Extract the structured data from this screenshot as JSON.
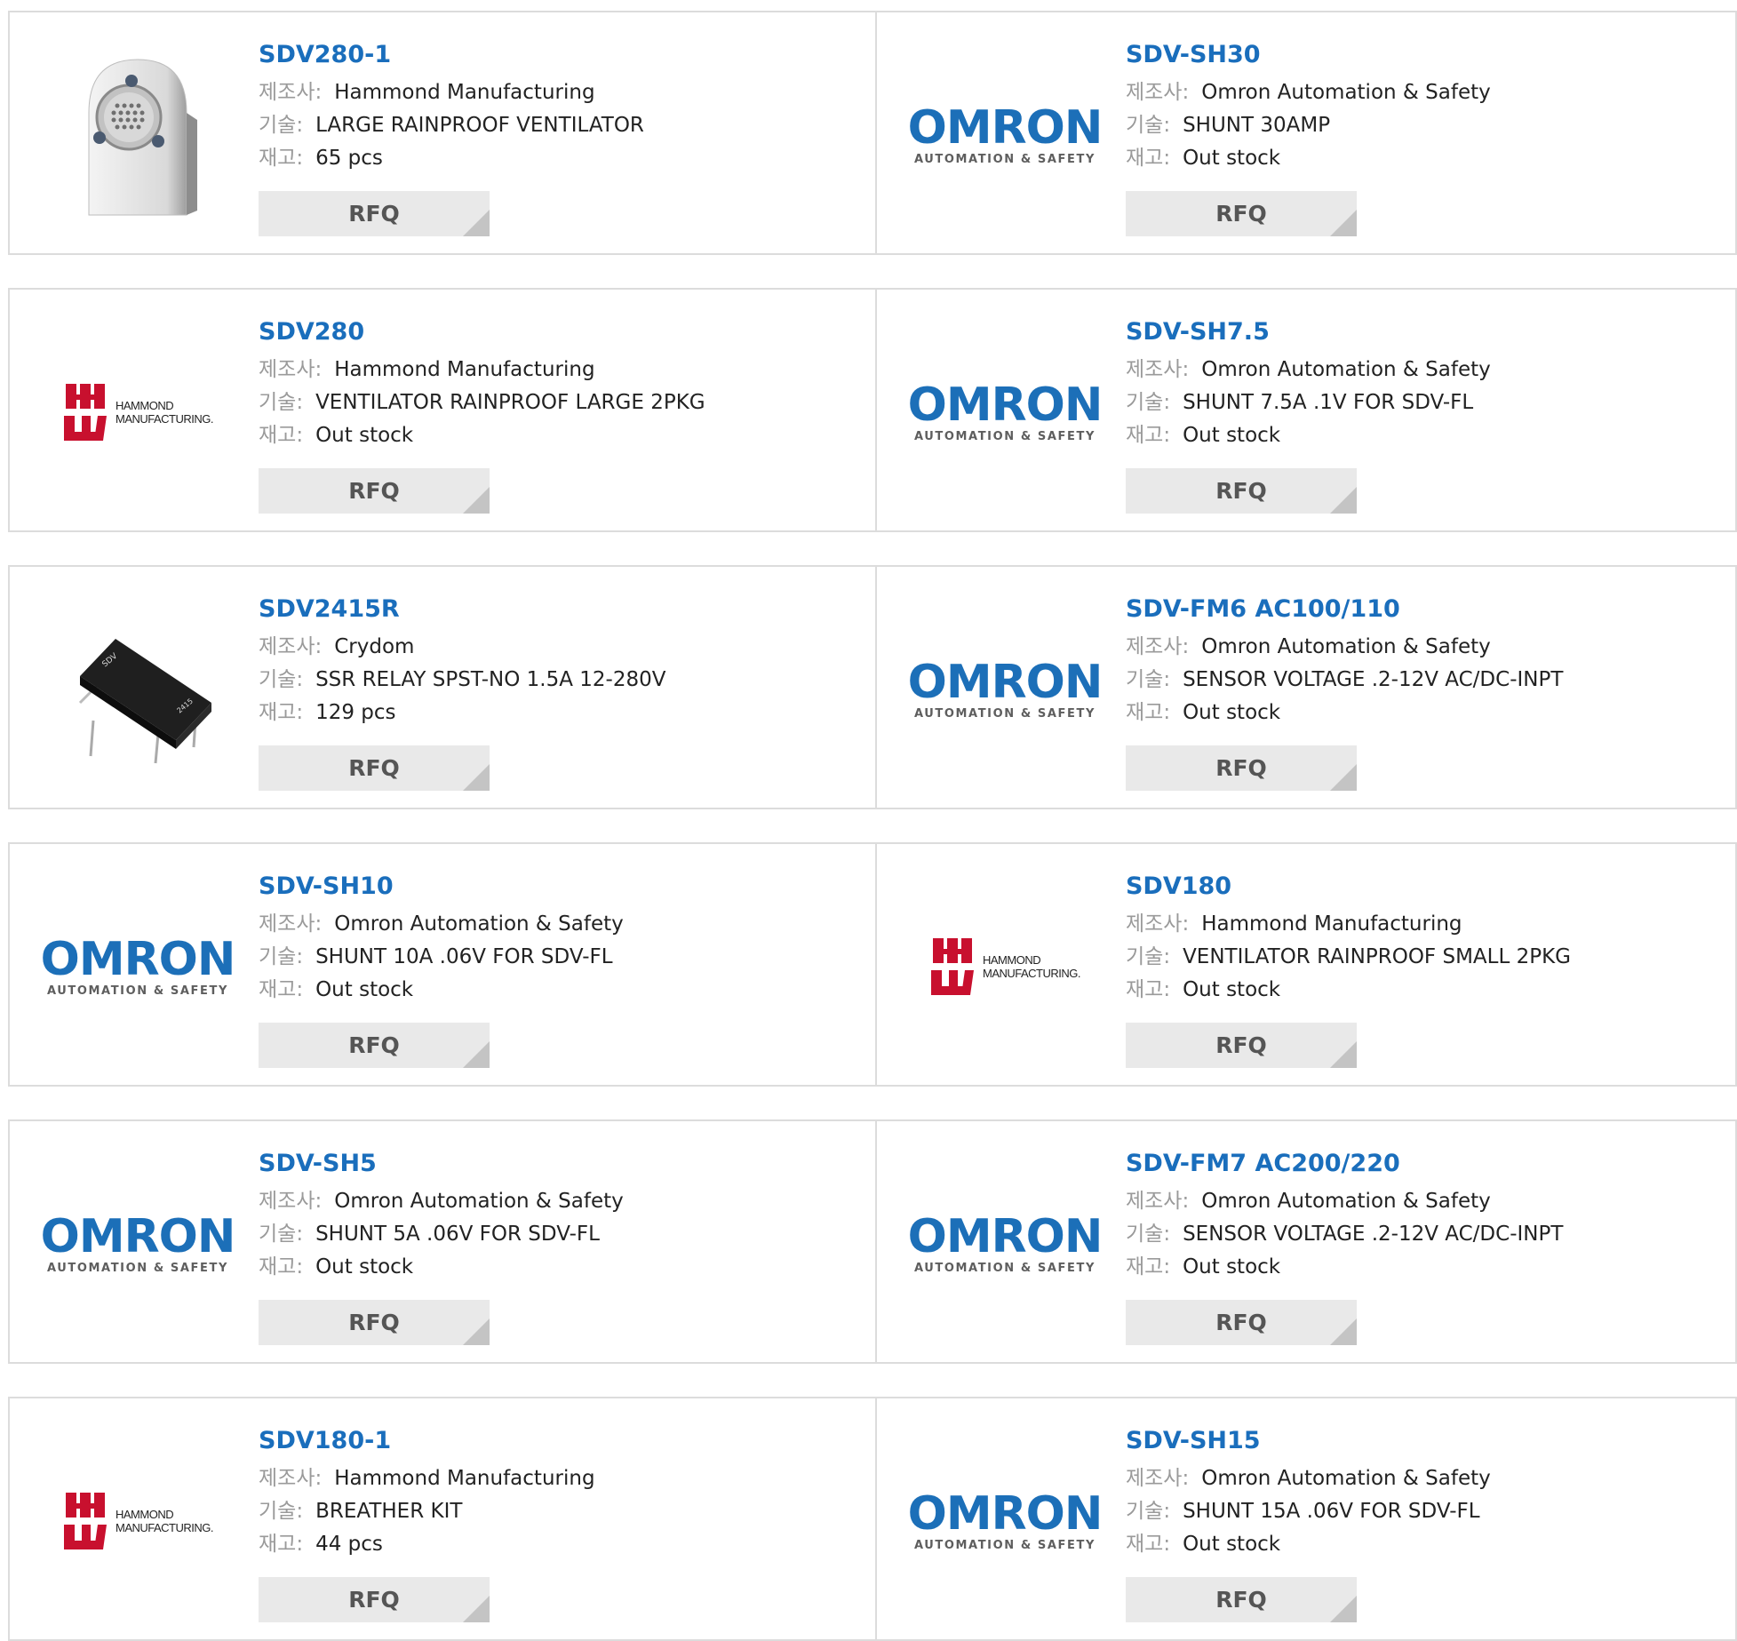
{
  "labels": {
    "manufacturer": "제조사",
    "description": "기술",
    "stock": "재고",
    "colon": ":"
  },
  "rfq_label": "RFQ",
  "logos": {
    "omron": {
      "name": "OMRON",
      "tagline": "AUTOMATION & SAFETY",
      "color": "#1c6fb8"
    },
    "hammond": {
      "line1": "HAMMOND",
      "line2": "MANUFACTURING.",
      "color": "#c8102e"
    }
  },
  "rows": [
    [
      {
        "part": "SDV280-1",
        "manufacturer": "Hammond Manufacturing",
        "description": "LARGE RAINPROOF VENTILATOR",
        "stock": "65 pcs",
        "image": "ventilator-photo"
      },
      {
        "part": "SDV-SH30",
        "manufacturer": "Omron Automation & Safety",
        "description": "SHUNT 30AMP",
        "stock": "Out stock",
        "image": "omron-logo"
      }
    ],
    [
      {
        "part": "SDV280",
        "manufacturer": "Hammond Manufacturing",
        "description": "VENTILATOR RAINPROOF LARGE 2PKG",
        "stock": "Out stock",
        "image": "hammond-logo"
      },
      {
        "part": "SDV-SH7.5",
        "manufacturer": "Omron Automation & Safety",
        "description": "SHUNT 7.5A .1V FOR SDV-FL",
        "stock": "Out stock",
        "image": "omron-logo"
      }
    ],
    [
      {
        "part": "SDV2415R",
        "manufacturer": "Crydom",
        "description": "SSR RELAY SPST-NO 1.5A 12-280V",
        "stock": "129 pcs",
        "image": "relay-photo"
      },
      {
        "part": "SDV-FM6 AC100/110",
        "manufacturer": "Omron Automation & Safety",
        "description": "SENSOR VOLTAGE .2-12V AC/DC-INPT",
        "stock": "Out stock",
        "image": "omron-logo"
      }
    ],
    [
      {
        "part": "SDV-SH10",
        "manufacturer": "Omron Automation & Safety",
        "description": "SHUNT 10A .06V FOR SDV-FL",
        "stock": "Out stock",
        "image": "omron-logo"
      },
      {
        "part": "SDV180",
        "manufacturer": "Hammond Manufacturing",
        "description": "VENTILATOR RAINPROOF SMALL 2PKG",
        "stock": "Out stock",
        "image": "hammond-logo"
      }
    ],
    [
      {
        "part": "SDV-SH5",
        "manufacturer": "Omron Automation & Safety",
        "description": "SHUNT 5A .06V FOR SDV-FL",
        "stock": "Out stock",
        "image": "omron-logo"
      },
      {
        "part": "SDV-FM7 AC200/220",
        "manufacturer": "Omron Automation & Safety",
        "description": "SENSOR VOLTAGE .2-12V AC/DC-INPT",
        "stock": "Out stock",
        "image": "omron-logo"
      }
    ],
    [
      {
        "part": "SDV180-1",
        "manufacturer": "Hammond Manufacturing",
        "description": "BREATHER KIT",
        "stock": "44 pcs",
        "image": "hammond-logo"
      },
      {
        "part": "SDV-SH15",
        "manufacturer": "Omron Automation & Safety",
        "description": "SHUNT 15A .06V FOR SDV-FL",
        "stock": "Out stock",
        "image": "omron-logo"
      }
    ]
  ]
}
